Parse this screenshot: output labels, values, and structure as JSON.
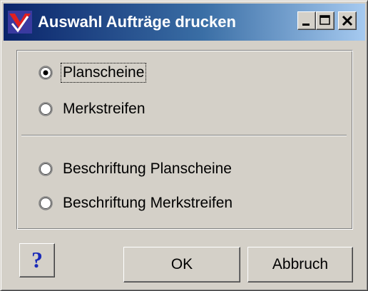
{
  "window": {
    "title": "Auswahl Aufträge drucken",
    "icon": "app-logo-icon",
    "controls": [
      "minimize-icon",
      "maximize-icon",
      "close-icon"
    ]
  },
  "options": {
    "group1": [
      {
        "label": "Planscheine",
        "checked": true,
        "focused": true
      },
      {
        "label": "Merkstreifen",
        "checked": false,
        "focused": false
      }
    ],
    "group2": [
      {
        "label": "Beschriftung Planscheine",
        "checked": false,
        "focused": false
      },
      {
        "label": "Beschriftung Merkstreifen",
        "checked": false,
        "focused": false
      }
    ]
  },
  "buttons": {
    "help_label": "?",
    "ok_label": "OK",
    "cancel_label": "Abbruch"
  },
  "colors": {
    "titlebar_start": "#0a246a",
    "titlebar_end": "#a6caf0",
    "face": "#d4d0c8",
    "help_icon": "#1a2ab8"
  }
}
